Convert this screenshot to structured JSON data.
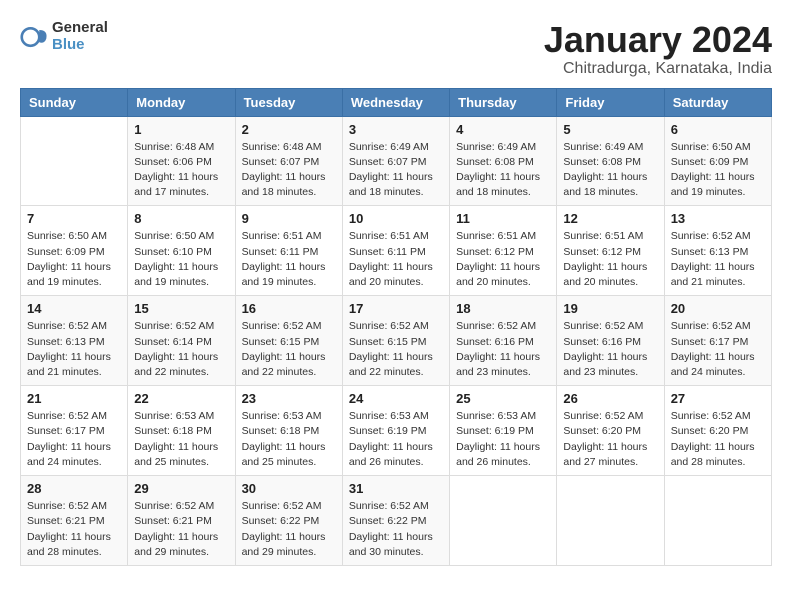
{
  "logo": {
    "general": "General",
    "blue": "Blue"
  },
  "title": "January 2024",
  "subtitle": "Chitradurga, Karnataka, India",
  "days_of_week": [
    "Sunday",
    "Monday",
    "Tuesday",
    "Wednesday",
    "Thursday",
    "Friday",
    "Saturday"
  ],
  "weeks": [
    [
      {
        "day": "",
        "info": ""
      },
      {
        "day": "1",
        "info": "Sunrise: 6:48 AM\nSunset: 6:06 PM\nDaylight: 11 hours and 17 minutes."
      },
      {
        "day": "2",
        "info": "Sunrise: 6:48 AM\nSunset: 6:07 PM\nDaylight: 11 hours and 18 minutes."
      },
      {
        "day": "3",
        "info": "Sunrise: 6:49 AM\nSunset: 6:07 PM\nDaylight: 11 hours and 18 minutes."
      },
      {
        "day": "4",
        "info": "Sunrise: 6:49 AM\nSunset: 6:08 PM\nDaylight: 11 hours and 18 minutes."
      },
      {
        "day": "5",
        "info": "Sunrise: 6:49 AM\nSunset: 6:08 PM\nDaylight: 11 hours and 18 minutes."
      },
      {
        "day": "6",
        "info": "Sunrise: 6:50 AM\nSunset: 6:09 PM\nDaylight: 11 hours and 19 minutes."
      }
    ],
    [
      {
        "day": "7",
        "info": "Sunrise: 6:50 AM\nSunset: 6:09 PM\nDaylight: 11 hours and 19 minutes."
      },
      {
        "day": "8",
        "info": "Sunrise: 6:50 AM\nSunset: 6:10 PM\nDaylight: 11 hours and 19 minutes."
      },
      {
        "day": "9",
        "info": "Sunrise: 6:51 AM\nSunset: 6:11 PM\nDaylight: 11 hours and 19 minutes."
      },
      {
        "day": "10",
        "info": "Sunrise: 6:51 AM\nSunset: 6:11 PM\nDaylight: 11 hours and 20 minutes."
      },
      {
        "day": "11",
        "info": "Sunrise: 6:51 AM\nSunset: 6:12 PM\nDaylight: 11 hours and 20 minutes."
      },
      {
        "day": "12",
        "info": "Sunrise: 6:51 AM\nSunset: 6:12 PM\nDaylight: 11 hours and 20 minutes."
      },
      {
        "day": "13",
        "info": "Sunrise: 6:52 AM\nSunset: 6:13 PM\nDaylight: 11 hours and 21 minutes."
      }
    ],
    [
      {
        "day": "14",
        "info": "Sunrise: 6:52 AM\nSunset: 6:13 PM\nDaylight: 11 hours and 21 minutes."
      },
      {
        "day": "15",
        "info": "Sunrise: 6:52 AM\nSunset: 6:14 PM\nDaylight: 11 hours and 22 minutes."
      },
      {
        "day": "16",
        "info": "Sunrise: 6:52 AM\nSunset: 6:15 PM\nDaylight: 11 hours and 22 minutes."
      },
      {
        "day": "17",
        "info": "Sunrise: 6:52 AM\nSunset: 6:15 PM\nDaylight: 11 hours and 22 minutes."
      },
      {
        "day": "18",
        "info": "Sunrise: 6:52 AM\nSunset: 6:16 PM\nDaylight: 11 hours and 23 minutes."
      },
      {
        "day": "19",
        "info": "Sunrise: 6:52 AM\nSunset: 6:16 PM\nDaylight: 11 hours and 23 minutes."
      },
      {
        "day": "20",
        "info": "Sunrise: 6:52 AM\nSunset: 6:17 PM\nDaylight: 11 hours and 24 minutes."
      }
    ],
    [
      {
        "day": "21",
        "info": "Sunrise: 6:52 AM\nSunset: 6:17 PM\nDaylight: 11 hours and 24 minutes."
      },
      {
        "day": "22",
        "info": "Sunrise: 6:53 AM\nSunset: 6:18 PM\nDaylight: 11 hours and 25 minutes."
      },
      {
        "day": "23",
        "info": "Sunrise: 6:53 AM\nSunset: 6:18 PM\nDaylight: 11 hours and 25 minutes."
      },
      {
        "day": "24",
        "info": "Sunrise: 6:53 AM\nSunset: 6:19 PM\nDaylight: 11 hours and 26 minutes."
      },
      {
        "day": "25",
        "info": "Sunrise: 6:53 AM\nSunset: 6:19 PM\nDaylight: 11 hours and 26 minutes."
      },
      {
        "day": "26",
        "info": "Sunrise: 6:52 AM\nSunset: 6:20 PM\nDaylight: 11 hours and 27 minutes."
      },
      {
        "day": "27",
        "info": "Sunrise: 6:52 AM\nSunset: 6:20 PM\nDaylight: 11 hours and 28 minutes."
      }
    ],
    [
      {
        "day": "28",
        "info": "Sunrise: 6:52 AM\nSunset: 6:21 PM\nDaylight: 11 hours and 28 minutes."
      },
      {
        "day": "29",
        "info": "Sunrise: 6:52 AM\nSunset: 6:21 PM\nDaylight: 11 hours and 29 minutes."
      },
      {
        "day": "30",
        "info": "Sunrise: 6:52 AM\nSunset: 6:22 PM\nDaylight: 11 hours and 29 minutes."
      },
      {
        "day": "31",
        "info": "Sunrise: 6:52 AM\nSunset: 6:22 PM\nDaylight: 11 hours and 30 minutes."
      },
      {
        "day": "",
        "info": ""
      },
      {
        "day": "",
        "info": ""
      },
      {
        "day": "",
        "info": ""
      }
    ]
  ]
}
